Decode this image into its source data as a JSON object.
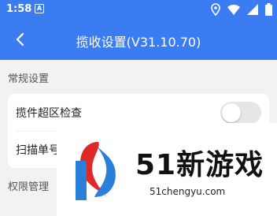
{
  "status_bar": {
    "time": "1:58",
    "badge": "A",
    "icons": [
      "location-icon",
      "wifi-icon",
      "signal-icon",
      "battery-icon"
    ]
  },
  "app_bar": {
    "title": "揽收设置(V31.10.70)",
    "back_icon": "back-arrow-icon"
  },
  "sections": {
    "general": "常规设置",
    "permissions": "权限管理"
  },
  "settings": {
    "cross_area_check": {
      "label": "揽件超区检查",
      "enabled": false
    },
    "scan_number": {
      "label": "扫描单号"
    }
  },
  "watermark": {
    "brand": "51新游戏",
    "url": "51chengyu.com"
  },
  "colors": {
    "primary": "#3c7cf2",
    "background": "#f2f2f2",
    "switch_off": "#e6e6e6",
    "logo_red": "#e02828",
    "logo_blue": "#2a7fd8"
  }
}
